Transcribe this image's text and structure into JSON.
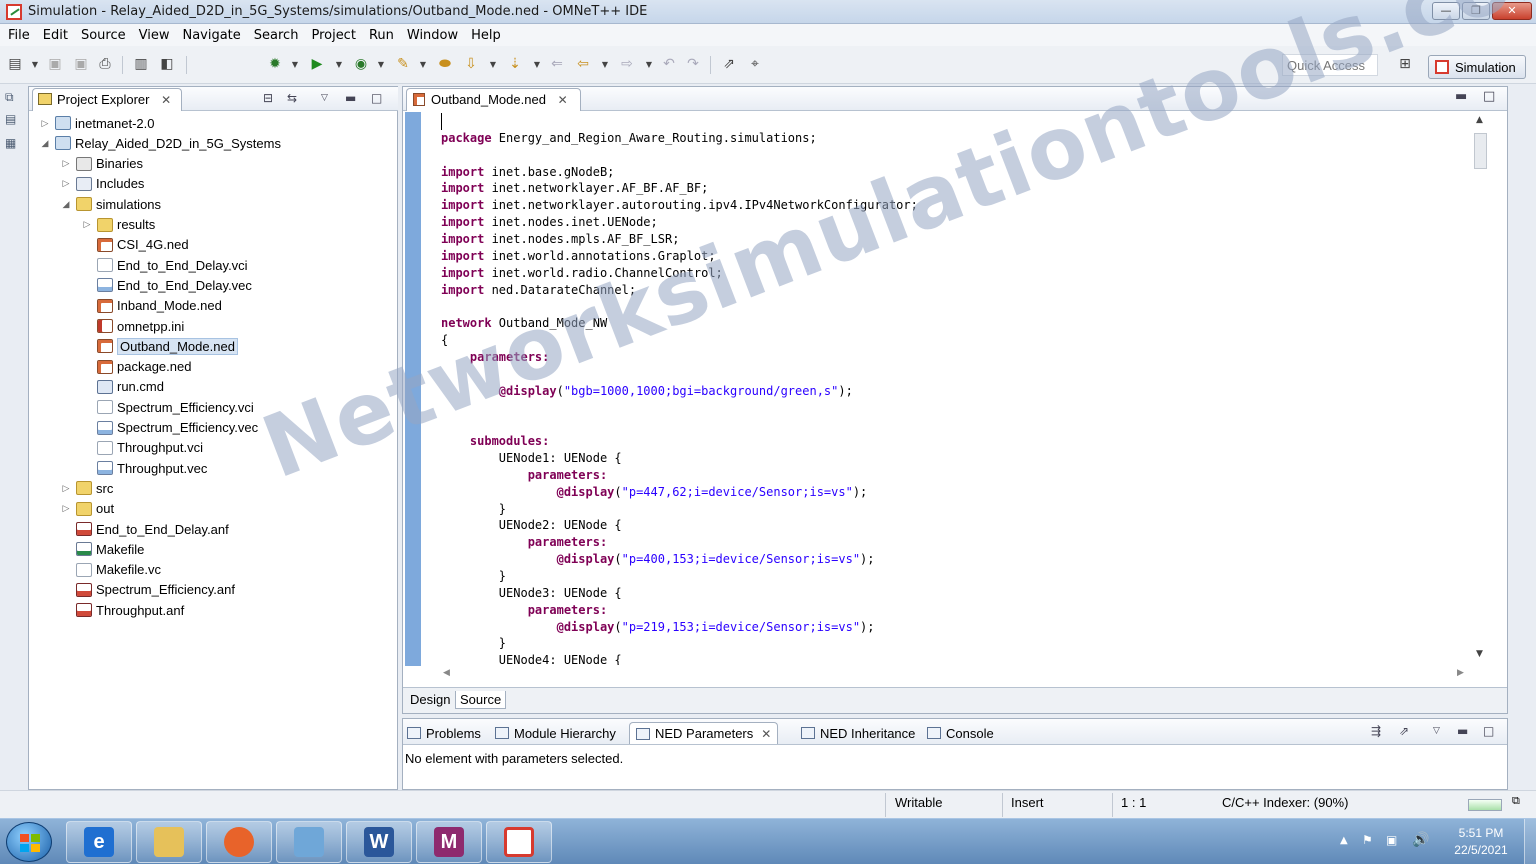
{
  "window": {
    "title": "Simulation - Relay_Aided_D2D_in_5G_Systems/simulations/Outband_Mode.ned - OMNeT++ IDE",
    "controls": [
      "minimize",
      "maximize",
      "close"
    ]
  },
  "menu": [
    "File",
    "Edit",
    "Source",
    "View",
    "Navigate",
    "Search",
    "Project",
    "Run",
    "Window",
    "Help"
  ],
  "toolbar": {
    "quick_access_placeholder": "Quick Access",
    "perspective_label": "Simulation"
  },
  "explorer": {
    "title": "Project Explorer",
    "tree": [
      {
        "label": "inetmanet-2.0",
        "icon": "project-icon",
        "level": 0,
        "expander": "collapsed"
      },
      {
        "label": "Relay_Aided_D2D_in_5G_Systems",
        "icon": "project-icon",
        "level": 0,
        "expander": "expanded"
      },
      {
        "label": "Binaries",
        "icon": "binaries-icon",
        "level": 1,
        "expander": "collapsed"
      },
      {
        "label": "Includes",
        "icon": "includes-icon",
        "level": 1,
        "expander": "collapsed"
      },
      {
        "label": "simulations",
        "icon": "folder-icon",
        "level": 1,
        "expander": "expanded"
      },
      {
        "label": "results",
        "icon": "folder-icon",
        "level": 2,
        "expander": "collapsed"
      },
      {
        "label": "CSI_4G.ned",
        "icon": "ned-file-icon",
        "level": 2,
        "expander": "none"
      },
      {
        "label": "End_to_End_Delay.vci",
        "icon": "file-icon",
        "level": 2,
        "expander": "none"
      },
      {
        "label": "End_to_End_Delay.vec",
        "icon": "vector-file-icon",
        "level": 2,
        "expander": "none"
      },
      {
        "label": "Inband_Mode.ned",
        "icon": "ned-file-icon",
        "level": 2,
        "expander": "none"
      },
      {
        "label": "omnetpp.ini",
        "icon": "ini-file-icon",
        "level": 2,
        "expander": "none"
      },
      {
        "label": "Outband_Mode.ned",
        "icon": "ned-file-icon",
        "level": 2,
        "expander": "none",
        "selected": true
      },
      {
        "label": "package.ned",
        "icon": "ned-file-icon",
        "level": 2,
        "expander": "none"
      },
      {
        "label": "run.cmd",
        "icon": "cmd-file-icon",
        "level": 2,
        "expander": "none"
      },
      {
        "label": "Spectrum_Efficiency.vci",
        "icon": "file-icon",
        "level": 2,
        "expander": "none"
      },
      {
        "label": "Spectrum_Efficiency.vec",
        "icon": "vector-file-icon",
        "level": 2,
        "expander": "none"
      },
      {
        "label": "Throughput.vci",
        "icon": "file-icon",
        "level": 2,
        "expander": "none"
      },
      {
        "label": "Throughput.vec",
        "icon": "vector-file-icon",
        "level": 2,
        "expander": "none"
      },
      {
        "label": "src",
        "icon": "folder-icon",
        "level": 1,
        "expander": "collapsed"
      },
      {
        "label": "out",
        "icon": "folder-icon",
        "level": 1,
        "expander": "collapsed"
      },
      {
        "label": "End_to_End_Delay.anf",
        "icon": "anf-file-icon",
        "level": 1,
        "expander": "none"
      },
      {
        "label": "Makefile",
        "icon": "makefile-icon",
        "level": 1,
        "expander": "none"
      },
      {
        "label": "Makefile.vc",
        "icon": "file-icon",
        "level": 1,
        "expander": "none"
      },
      {
        "label": "Spectrum_Efficiency.anf",
        "icon": "anf-file-icon",
        "level": 1,
        "expander": "none"
      },
      {
        "label": "Throughput.anf",
        "icon": "anf-file-icon",
        "level": 1,
        "expander": "none"
      }
    ]
  },
  "editor": {
    "tab_label": "Outband_Mode.ned",
    "code_lines": [
      "",
      "package Energy_and_Region_Aware_Routing.simulations;",
      "",
      "import inet.base.gNodeB;",
      "import inet.networklayer.AF_BF.AF_BF;",
      "import inet.networklayer.autorouting.ipv4.IPv4NetworkConfigurator;",
      "import inet.nodes.inet.UENode;",
      "import inet.nodes.mpls.AF_BF_LSR;",
      "import inet.world.annotations.Graplot;",
      "import inet.world.radio.ChannelControl;",
      "import ned.DatarateChannel;",
      "",
      "network Outband_Mode_NW",
      "{",
      "    parameters:",
      "",
      "        @display(\"bgb=1000,1000;bgi=background/green,s\");",
      "",
      "",
      "    submodules:",
      "        UENode1: UENode {",
      "            parameters:",
      "                @display(\"p=447,62;i=device/Sensor;is=vs\");",
      "        }",
      "        UENode2: UENode {",
      "            parameters:",
      "                @display(\"p=400,153;i=device/Sensor;is=vs\");",
      "        }",
      "        UENode3: UENode {",
      "            parameters:",
      "                @display(\"p=219,153;i=device/Sensor;is=vs\");",
      "        }",
      "        UENode4: UENode {"
    ],
    "bottom_tabs": [
      "Design",
      "Source"
    ],
    "active_bottom_tab": "Source"
  },
  "watermark": "Networksimulationtools.com",
  "bottom_panel": {
    "tabs": [
      {
        "label": "Problems",
        "icon": "problems-icon"
      },
      {
        "label": "Module Hierarchy",
        "icon": "hierarchy-icon"
      },
      {
        "label": "NED Parameters",
        "icon": "ned-parameters-icon",
        "active": true
      },
      {
        "label": "NED Inheritance",
        "icon": "inheritance-icon"
      },
      {
        "label": "Console",
        "icon": "console-icon"
      }
    ],
    "message": "No element with parameters selected."
  },
  "status": {
    "writable": "Writable",
    "insert_mode": "Insert",
    "position": "1 : 1",
    "indexer": "C/C++ Indexer: (90%)",
    "indexer_progress": 0.9
  },
  "taskbar": {
    "apps": [
      {
        "name": "internet-explorer-icon",
        "glyph": "e",
        "color": "#1f6fd1"
      },
      {
        "name": "file-explorer-icon",
        "glyph": "",
        "color": "#e6c15a"
      },
      {
        "name": "firefox-icon",
        "glyph": "",
        "color": "#e8632a"
      },
      {
        "name": "notepad-icon",
        "glyph": "",
        "color": "#6fa7d8"
      },
      {
        "name": "word-icon",
        "glyph": "W",
        "color": "#2b579a"
      },
      {
        "name": "matlab-icon",
        "glyph": "M",
        "color": "#8e2a6e"
      },
      {
        "name": "omnetpp-icon",
        "glyph": "",
        "color": "#ffffff"
      }
    ],
    "clock_time": "5:51 PM",
    "clock_date": "22/5/2021"
  }
}
